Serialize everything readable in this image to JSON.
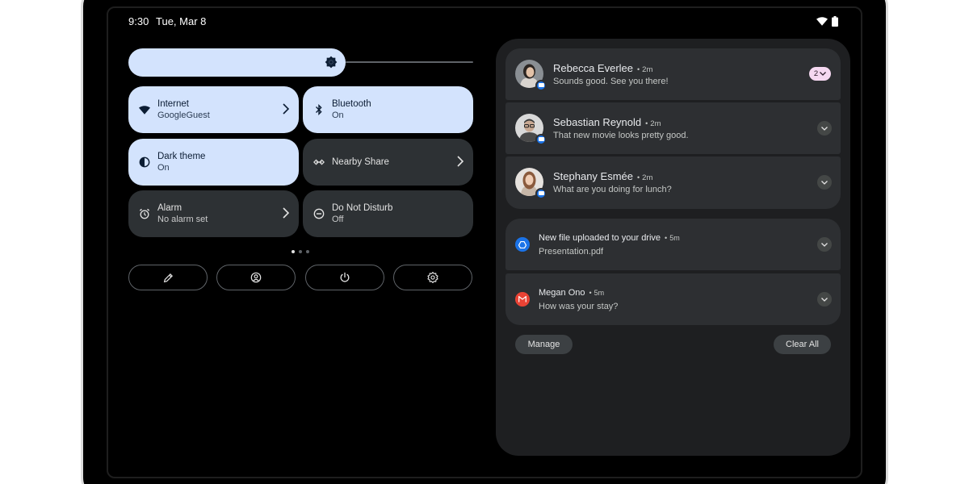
{
  "status_bar": {
    "time": "9:30",
    "date": "Tue, Mar 8"
  },
  "quick_settings": {
    "brightness_level": 0.63,
    "tiles": [
      {
        "title": "Internet",
        "subtitle": "GoogleGuest",
        "state": "on",
        "icon": "wifi-icon",
        "chevron": true
      },
      {
        "title": "Bluetooth",
        "subtitle": "On",
        "state": "on",
        "icon": "bluetooth-icon",
        "chevron": false
      },
      {
        "title": "Dark theme",
        "subtitle": "On",
        "state": "on",
        "icon": "dark-theme-icon",
        "chevron": false
      },
      {
        "title": "Nearby Share",
        "subtitle": "",
        "state": "off",
        "icon": "nearby-share-icon",
        "chevron": true
      },
      {
        "title": "Alarm",
        "subtitle": "No alarm set",
        "state": "off",
        "icon": "alarm-icon",
        "chevron": true
      },
      {
        "title": "Do Not Disturb",
        "subtitle": "Off",
        "state": "off",
        "icon": "dnd-icon",
        "chevron": false
      }
    ],
    "page_dots": {
      "count": 3,
      "active": 0
    },
    "actions": [
      "edit-icon",
      "user-switch-icon",
      "power-icon",
      "settings-icon"
    ]
  },
  "notifications": {
    "messages": [
      {
        "name": "Rebecca Everlee",
        "time": "2m",
        "body": "Sounds good. See you there!",
        "count": "2"
      },
      {
        "name": "Sebastian Reynold",
        "time": "2m",
        "body": "That new movie looks pretty good."
      },
      {
        "name": "Stephany Esmée",
        "time": "2m",
        "body": "What are you doing for lunch?"
      }
    ],
    "drive": {
      "title": "New file uploaded to your drive",
      "time": "5m",
      "body": "Presentation.pdf"
    },
    "gmail": {
      "title": "Megan Ono",
      "time": "5m",
      "body": "How was your stay?"
    },
    "manage_label": "Manage",
    "clear_all_label": "Clear All"
  },
  "colors": {
    "tile_on": "#d3e3fd",
    "tile_off": "#2d3134",
    "panel": "#1e1f21",
    "card": "#2d2f32",
    "count_pill": "#f5d8f1",
    "drive_blue": "#1a73e8",
    "gmail_red": "#ea4335"
  }
}
